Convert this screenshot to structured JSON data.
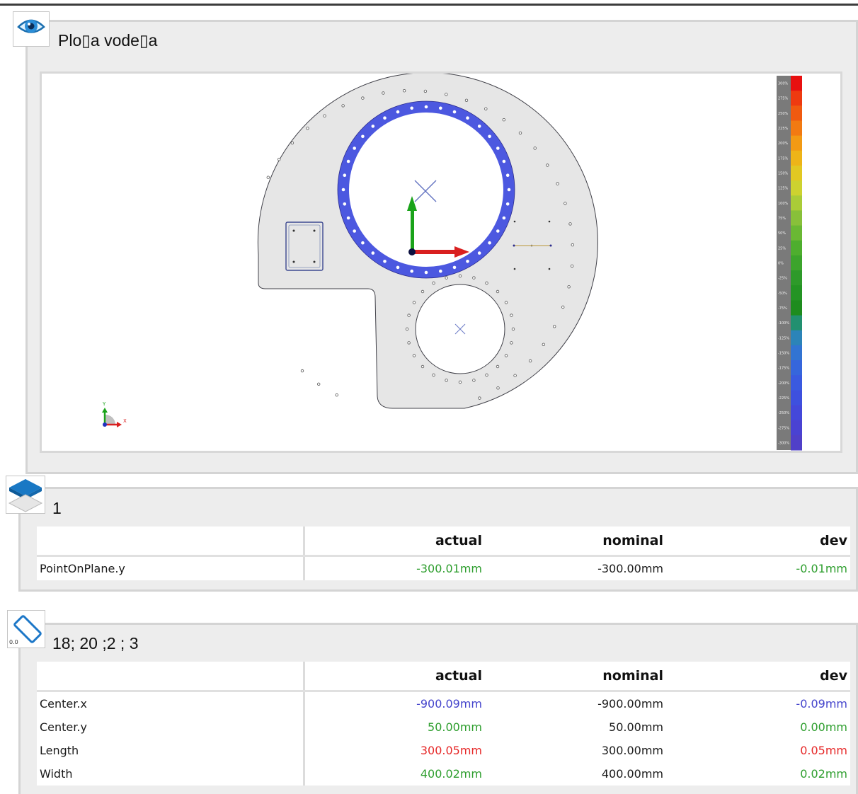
{
  "view": {
    "title": "Plo▯a vode▯a",
    "icon": "eye-icon",
    "legend_labels": [
      "300%",
      "275%",
      "250%",
      "225%",
      "200%",
      "175%",
      "150%",
      "125%",
      "100%",
      "75%",
      "50%",
      "25%",
      "0%",
      "-25%",
      "-50%",
      "-75%",
      "-100%",
      "-125%",
      "-150%",
      "-175%",
      "-200%",
      "-225%",
      "-250%",
      "-275%",
      "-300%"
    ],
    "legend_colors": [
      "#e81010",
      "#ee3a10",
      "#f05a10",
      "#f27a12",
      "#f29a14",
      "#eeb418",
      "#e2c822",
      "#cdd230",
      "#aacc38",
      "#88c03a",
      "#6ab834",
      "#4eae2e",
      "#3ca42c",
      "#2e9a2a",
      "#249424",
      "#1e8c1e",
      "#229070",
      "#2c84b8",
      "#3274d2",
      "#3666dc",
      "#3a5ae0",
      "#3e50de",
      "#4448da",
      "#4a42d2",
      "#5040c8"
    ],
    "axis_labels": {
      "x": "X",
      "y": "Y"
    }
  },
  "table1": {
    "title": "1",
    "icon": "plane-icon",
    "headers": [
      "",
      "actual",
      "nominal",
      "dev"
    ],
    "rows": [
      {
        "name": "PointOnPlane.y",
        "actual": "-300.01mm",
        "nominal": "-300.00mm",
        "dev": "-0.01mm",
        "status_color": "green"
      }
    ]
  },
  "table2": {
    "title": "18; 20 ;2 ; 3",
    "icon": "slot-icon",
    "icon_label": "0.0",
    "headers": [
      "",
      "actual",
      "nominal",
      "dev"
    ],
    "rows": [
      {
        "name": "Center.x",
        "actual": "-900.09mm",
        "nominal": "-900.00mm",
        "dev": "-0.09mm",
        "status_color": "blue"
      },
      {
        "name": "Center.y",
        "actual": "50.00mm",
        "nominal": "50.00mm",
        "dev": "0.00mm",
        "status_color": "green"
      },
      {
        "name": "Length",
        "actual": "300.05mm",
        "nominal": "300.00mm",
        "dev": "0.05mm",
        "status_color": "red"
      },
      {
        "name": "Width",
        "actual": "400.02mm",
        "nominal": "400.00mm",
        "dev": "0.02mm",
        "status_color": "green"
      }
    ]
  },
  "colors": {
    "green": "#2e9e2e",
    "blue": "#4444cc",
    "red": "#e62828",
    "ring": "#4c58e0"
  }
}
